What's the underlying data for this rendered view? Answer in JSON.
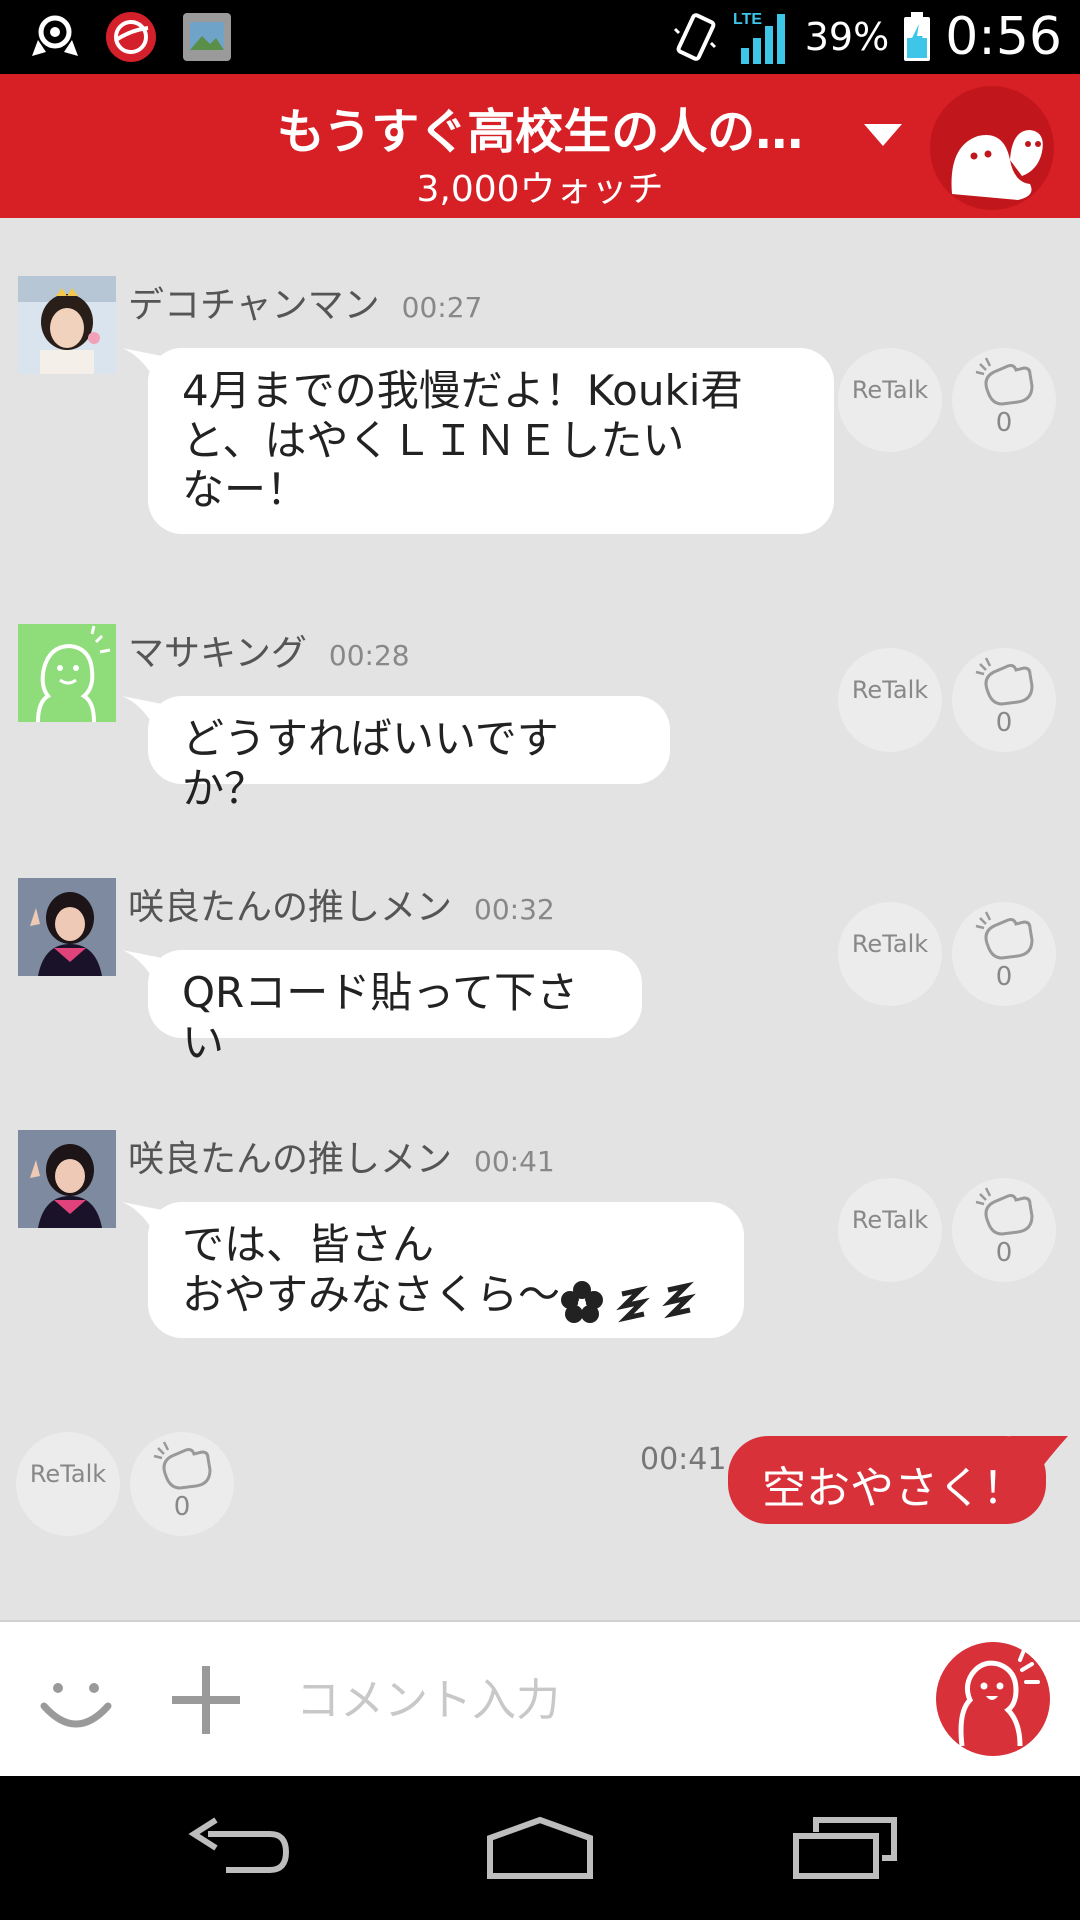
{
  "status_bar": {
    "battery_text": "39%",
    "time": "0:56",
    "network": "LTE",
    "icons": [
      "notification-icon",
      "security-app-icon",
      "gallery-icon",
      "vibrate-icon",
      "signal-icon",
      "battery-charging-icon"
    ]
  },
  "header": {
    "title": "もうすぐ高校生の人の…",
    "subtitle": "3,000ウォッチ",
    "accent_color": "#d71f26"
  },
  "messages": [
    {
      "sender": "デコチャンマン",
      "time": "00:27",
      "text": "4月までの我慢だよ！Kouki君\nと、はやくＬＩＮＥしたい\nなー！",
      "retalk": "ReTalk",
      "claps": "0"
    },
    {
      "sender": "マサキング",
      "time": "00:28",
      "text": "どうすればいいですか？",
      "retalk": "ReTalk",
      "claps": "0"
    },
    {
      "sender": "咲良たんの推しメン",
      "time": "00:32",
      "text": "QRコード貼って下さい",
      "retalk": "ReTalk",
      "claps": "0"
    },
    {
      "sender": "咲良たんの推しメン",
      "time": "00:41",
      "text": "では、皆さん\nおやすみなさくら〜",
      "retalk": "ReTalk",
      "claps": "0"
    }
  ],
  "own_message": {
    "time": "00:41",
    "text": "空おやさく！",
    "retalk": "ReTalk",
    "claps": "0",
    "bubble_color": "#d93139"
  },
  "input": {
    "placeholder": "コメント入力"
  }
}
